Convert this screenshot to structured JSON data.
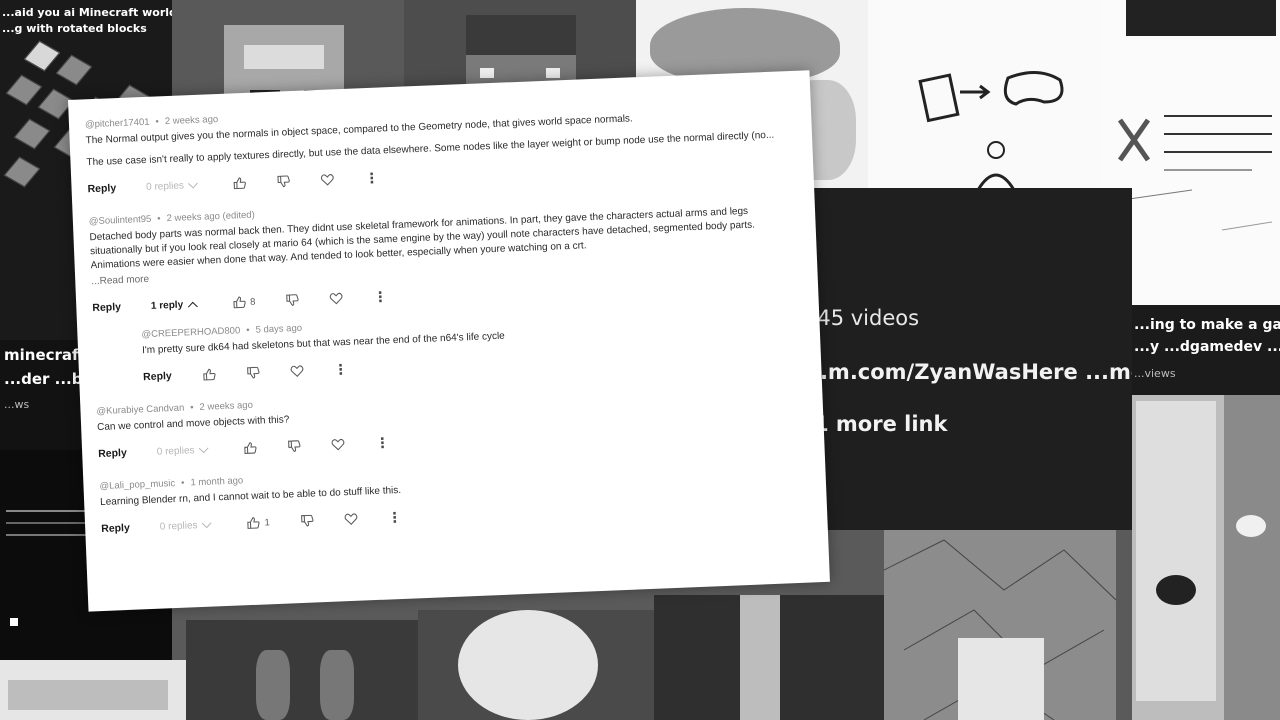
{
  "background": {
    "cubes_title_line1": "...aid you ai Minecraft world",
    "cubes_title_line2": "...g with rotated blocks",
    "left_title_line1": "minecraft",
    "left_title_line2": "...der ...blend",
    "left_views": "...ws",
    "channel_count": "· 45 videos",
    "channel_link": "...m.com/ZyanWasHere ...more",
    "channel_more_links": "1 more link",
    "side_title_line1": "...ing to make a game",
    "side_title_line2": "...y ...dgamedev ...",
    "side_views": "...views"
  },
  "comments": [
    {
      "author": "@pitcher17401",
      "time": "2 weeks ago",
      "paragraphs": [
        "The Normal output gives you the normals in object space, compared to the Geometry node, that gives world space normals.",
        "The use case isn't really to apply textures directly, but use the data elsewhere. Some nodes like the layer weight or bump node use the normal directly (no..."
      ],
      "reply_label": "Reply",
      "replies_label": "0 replies",
      "like_count": "",
      "replies_active": false
    },
    {
      "author": "@Soulintent95",
      "time": "2 weeks ago (edited)",
      "paragraphs": [
        "Detached body parts was normal back then. They didnt use skeletal framework for animations. In part, they gave the characters actual arms and legs situationally but if you look real closely at mario 64 (which is the same engine by the way) youll note characters have detached, segmented body parts. Animations were easier when done that way. And tended to look better, especially when youre watching on a crt."
      ],
      "read_more": "...Read more",
      "reply_label": "Reply",
      "replies_label": "1 reply",
      "like_count": "8",
      "replies_active": true
    },
    {
      "author": "@CREEPERHOAD800",
      "time": "5 days ago",
      "paragraphs": [
        "I'm pretty sure dk64 had skeletons but that was near the end of the n64's life cycle"
      ],
      "reply_label": "Reply",
      "replies_label": "",
      "like_count": "",
      "is_reply": true
    },
    {
      "author": "@Kurabiye Candvan",
      "time": "2 weeks ago",
      "paragraphs": [
        "Can we control and move objects with this?"
      ],
      "reply_label": "Reply",
      "replies_label": "0 replies",
      "like_count": "",
      "replies_active": false
    },
    {
      "author": "@Lali_pop_music",
      "time": "1 month ago",
      "paragraphs": [
        "Learning Blender rn, and I cannot wait to be able to do stuff like this."
      ],
      "reply_label": "Reply",
      "replies_label": "0 replies",
      "like_count": "1",
      "replies_active": false
    }
  ],
  "icons": {
    "like": "thumbs-up-icon",
    "dislike": "thumbs-down-icon",
    "heart": "heart-icon",
    "more": "more-vertical-icon"
  }
}
